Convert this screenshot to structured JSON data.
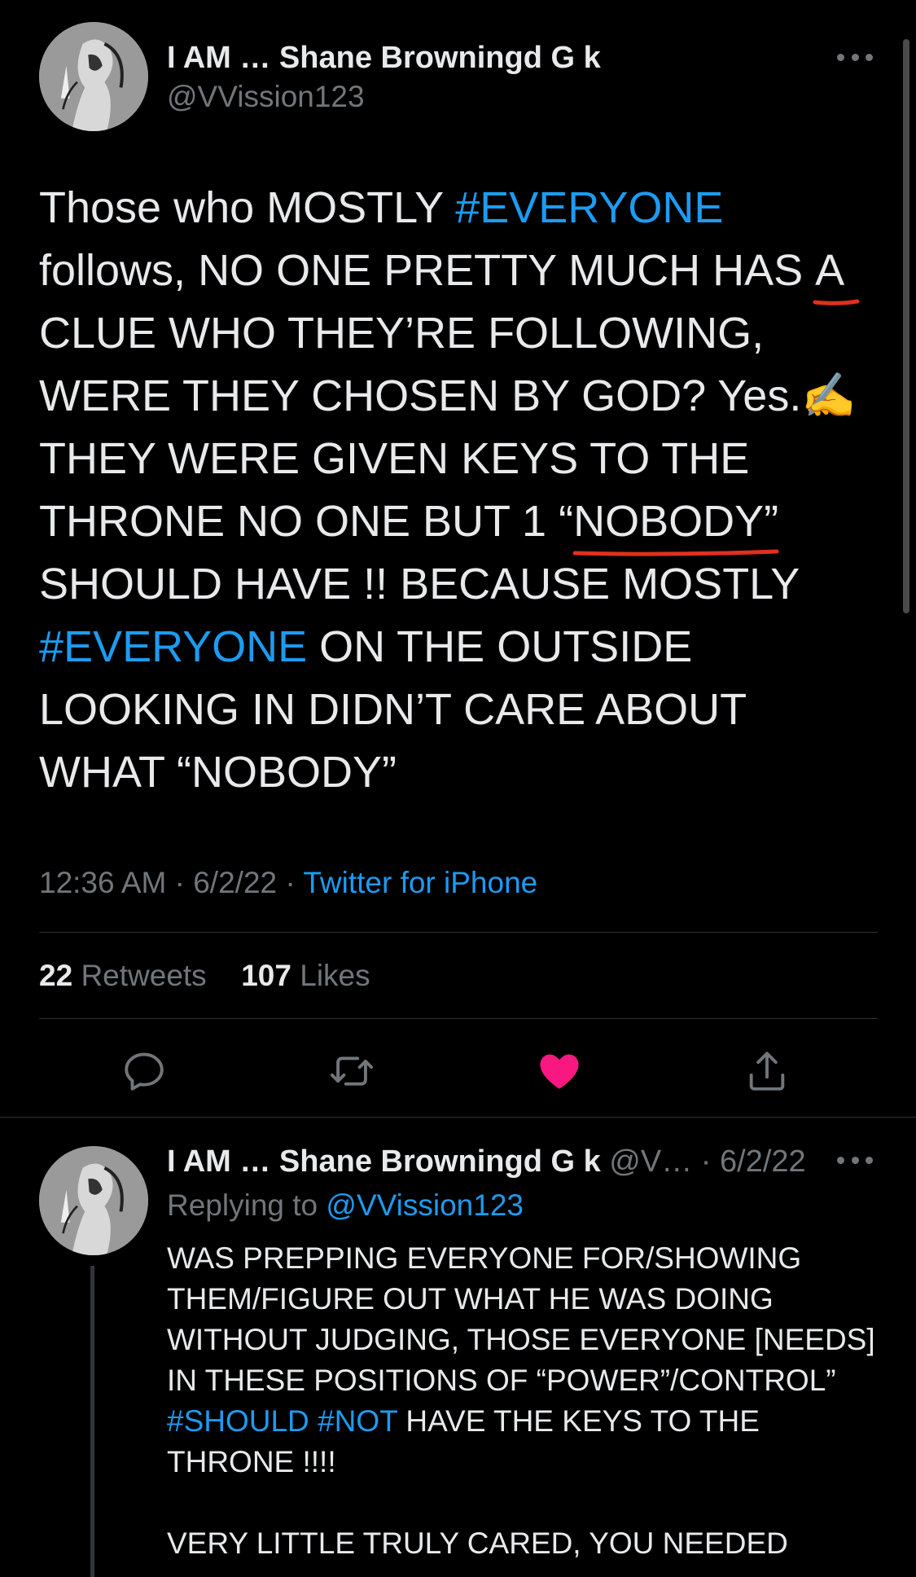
{
  "colors": {
    "background": "#000000",
    "text": "#e7e9ea",
    "secondary": "#71767b",
    "link": "#1d9bf0",
    "like": "#f91880",
    "annotation": "#e0301e"
  },
  "tweet": {
    "author_name": "I AM … Shane Browningd G k",
    "handle": "@VVission123",
    "text_lines": [
      [
        "Those who MOSTLY ",
        "#EVERYONE"
      ],
      [
        "follows, NO ONE PRETTY MUCH HAS ",
        "A"
      ],
      [
        "CLUE WHO THEY’RE FOLLOWING,"
      ],
      [
        "WERE THEY CHOSEN BY GOD? Yes.",
        "✍️"
      ],
      [
        "THEY WERE GIVEN KEYS TO THE"
      ],
      [
        "THRONE NO ONE BUT 1 “",
        "NOBODY",
        "”"
      ],
      [
        "SHOULD HAVE !! BECAUSE MOSTLY"
      ],
      [
        "#EVERYONE",
        " ON THE OUTSIDE"
      ],
      [
        "LOOKING IN DIDN’T CARE ABOUT"
      ],
      [
        "WHAT “NOBODY”"
      ]
    ],
    "time": "12:36 AM",
    "date": "6/2/22",
    "separator": " · ",
    "source": "Twitter for iPhone",
    "retweets_count": "22",
    "retweets_label": "Retweets",
    "likes_count": "107",
    "likes_label": "Likes",
    "actions": [
      "reply-icon",
      "retweet-icon",
      "like-icon",
      "share-icon"
    ],
    "liked": true
  },
  "reply": {
    "author_name": "I AM … Shane Browningd G k",
    "handle_truncated": "@V…",
    "separator": " · ",
    "date": "6/2/22",
    "replying_to_label": "Replying to ",
    "replying_to_handle": "@VVission123",
    "text_lines": [
      [
        "WAS PREPPING EVERYONE FOR/SHOWING"
      ],
      [
        "THEM/FIGURE OUT WHAT HE WAS DOING"
      ],
      [
        "WITHOUT JUDGING, THOSE EVERYONE [NEEDS]"
      ],
      [
        "IN THESE POSITIONS OF “POWER”/CONTROL”"
      ],
      [
        "#SHOULD",
        " ",
        "#NOT",
        " HAVE THE KEYS TO THE"
      ],
      [
        "THRONE !!!!"
      ],
      [
        ""
      ],
      [
        "VERY LITTLE TRULY CARED, YOU NEEDED"
      ]
    ]
  }
}
